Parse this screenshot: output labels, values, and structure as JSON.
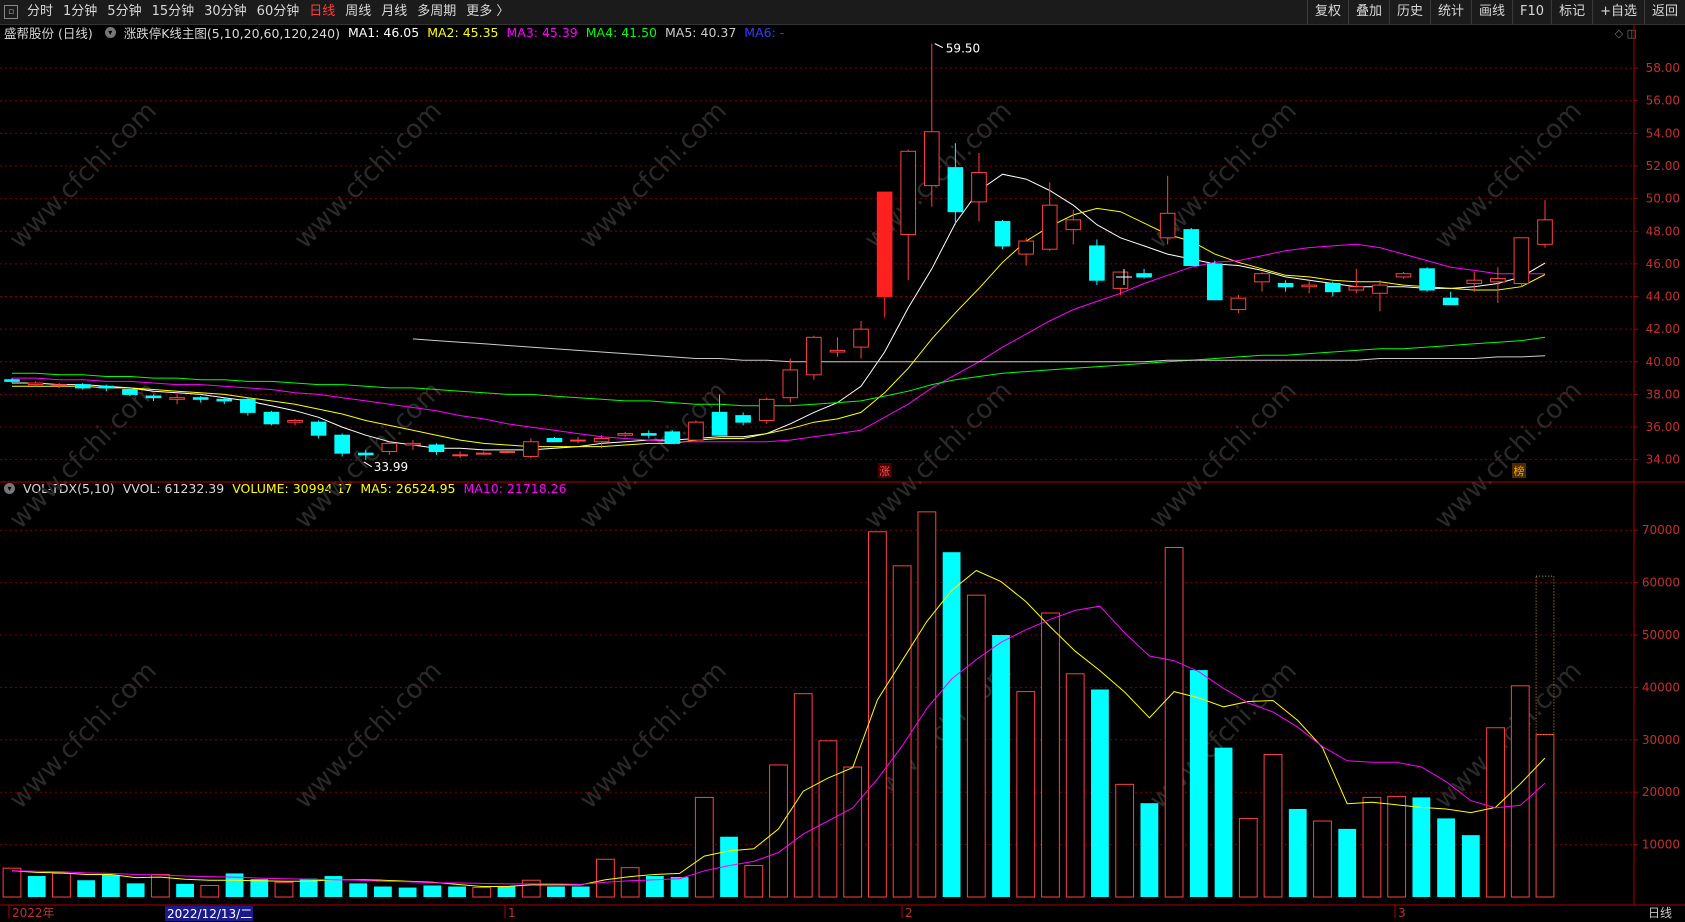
{
  "toolbar": {
    "icon": "window-menu-icon",
    "periods": [
      "分时",
      "1分钟",
      "5分钟",
      "15分钟",
      "30分钟",
      "60分钟",
      "日线",
      "周线",
      "月线",
      "多周期",
      "更多 〉"
    ],
    "active_period": "日线",
    "right_buttons": [
      "复权",
      "叠加",
      "历史",
      "统计",
      "画线",
      "F10",
      "标记",
      "+自选",
      "返回"
    ]
  },
  "price_panel": {
    "stock": "盛帮股份 (日线)",
    "indicator": "涨跌停K线主图(5,10,20,60,120,240)",
    "ma1": "MA1: 46.05",
    "ma2": "MA2: 45.35",
    "ma3": "MA3: 45.39",
    "ma4": "MA4: 41.50",
    "ma5": "MA5: 40.37",
    "ma6": "MA6: -",
    "high_label": "59.50",
    "low_label": "33.99",
    "limit_up_mark": "涨",
    "rank_mark": "榜",
    "corner_icons": "◇ ◫"
  },
  "volume_panel": {
    "indicator": "VOL-TDX(5,10)",
    "vvol": "VVOL: 61232.39",
    "volume": "VOLUME: 30994.17",
    "ma5": "MA5: 26524.95",
    "ma10": "MA10: 21718.26"
  },
  "time_axis": {
    "labels": [
      "2022年",
      "1",
      "2",
      "3"
    ],
    "cursor_date": "2022/12/13/二",
    "period_label": "日线"
  },
  "watermark": "www.cfchi.com",
  "colors": {
    "up": "#ff4040",
    "down": "#00ffff",
    "ma1": "#ffffff",
    "ma2": "#ffff00",
    "ma3": "#ff00ff",
    "ma4": "#00ff00",
    "ma5": "#cccccc",
    "ma6": "#0000ff",
    "grid": "#7a0000"
  },
  "chart_data": [
    {
      "type": "candlestick",
      "title": "盛帮股份 (日线)",
      "y_ticks": [
        34.0,
        36.0,
        38.0,
        40.0,
        42.0,
        44.0,
        46.0,
        48.0,
        50.0,
        52.0,
        54.0,
        56.0,
        58.0
      ],
      "ylim": [
        33.0,
        59.6
      ],
      "ohlc": [
        [
          38.9,
          39.0,
          38.7,
          38.8
        ],
        [
          38.6,
          38.8,
          38.5,
          38.7
        ],
        [
          38.6,
          38.7,
          38.4,
          38.6
        ],
        [
          38.6,
          38.7,
          38.3,
          38.4
        ],
        [
          38.5,
          38.6,
          38.2,
          38.4
        ],
        [
          38.3,
          38.4,
          37.9,
          38.0
        ],
        [
          37.9,
          38.0,
          37.6,
          37.8
        ],
        [
          37.7,
          38.0,
          37.4,
          37.8
        ],
        [
          37.8,
          37.9,
          37.5,
          37.7
        ],
        [
          37.7,
          37.8,
          37.4,
          37.6
        ],
        [
          37.7,
          37.8,
          36.7,
          36.9
        ],
        [
          36.9,
          37.0,
          36.1,
          36.2
        ],
        [
          36.3,
          36.5,
          36.1,
          36.4
        ],
        [
          36.3,
          36.4,
          35.3,
          35.5
        ],
        [
          35.5,
          35.6,
          34.2,
          34.4
        ],
        [
          34.4,
          34.6,
          33.99,
          34.3
        ],
        [
          34.5,
          35.1,
          34.3,
          35.0
        ],
        [
          34.9,
          35.2,
          34.6,
          35.0
        ],
        [
          34.9,
          35.0,
          34.3,
          34.5
        ],
        [
          34.3,
          34.5,
          34.1,
          34.3
        ],
        [
          34.4,
          34.5,
          34.3,
          34.4
        ],
        [
          34.5,
          34.6,
          34.4,
          34.5
        ],
        [
          34.2,
          35.3,
          34.1,
          35.1
        ],
        [
          35.3,
          35.4,
          35.1,
          35.1
        ],
        [
          35.2,
          35.4,
          35.0,
          35.2
        ],
        [
          35.1,
          35.5,
          34.7,
          35.3
        ],
        [
          35.5,
          35.7,
          35.4,
          35.6
        ],
        [
          35.6,
          35.8,
          35.3,
          35.5
        ],
        [
          35.7,
          35.8,
          35.0,
          35.0
        ],
        [
          35.2,
          36.4,
          35.1,
          36.3
        ],
        [
          36.9,
          38.0,
          35.8,
          35.5
        ],
        [
          36.7,
          36.9,
          36.1,
          36.3
        ],
        [
          36.4,
          37.8,
          36.2,
          37.7
        ],
        [
          37.8,
          40.2,
          37.5,
          39.5
        ],
        [
          39.2,
          41.6,
          38.9,
          41.5
        ],
        [
          40.6,
          41.5,
          40.3,
          40.7
        ],
        [
          40.9,
          42.5,
          40.2,
          42.0
        ],
        [
          44.0,
          50.4,
          42.7,
          50.4
        ],
        [
          47.8,
          53.0,
          45.0,
          52.9
        ],
        [
          50.8,
          59.5,
          49.5,
          54.1
        ],
        [
          51.9,
          53.4,
          48.4,
          49.2
        ],
        [
          49.8,
          52.8,
          48.6,
          51.6
        ],
        [
          48.6,
          48.7,
          46.9,
          47.1
        ],
        [
          46.6,
          47.6,
          45.9,
          47.4
        ],
        [
          46.9,
          51.0,
          46.8,
          49.6
        ],
        [
          48.1,
          49.3,
          47.2,
          48.7
        ],
        [
          47.1,
          47.5,
          44.7,
          45.0
        ],
        [
          44.5,
          45.5,
          44.1,
          45.5
        ],
        [
          45.4,
          45.7,
          45.1,
          45.2
        ],
        [
          47.6,
          51.4,
          47.2,
          49.1
        ],
        [
          48.1,
          48.2,
          45.9,
          45.9
        ],
        [
          46.0,
          46.2,
          43.8,
          43.8
        ],
        [
          43.2,
          44.1,
          43.0,
          43.9
        ],
        [
          44.9,
          45.5,
          44.3,
          45.4
        ],
        [
          44.8,
          45.0,
          44.3,
          44.6
        ],
        [
          44.6,
          45.0,
          44.2,
          44.7
        ],
        [
          44.8,
          44.9,
          44.0,
          44.3
        ],
        [
          44.4,
          45.7,
          44.2,
          44.6
        ],
        [
          44.2,
          45.0,
          43.1,
          44.7
        ],
        [
          45.2,
          45.5,
          45.1,
          45.4
        ],
        [
          45.7,
          45.8,
          44.3,
          44.4
        ],
        [
          43.9,
          44.3,
          43.5,
          43.5
        ],
        [
          44.8,
          45.5,
          44.3,
          45.0
        ],
        [
          44.9,
          45.8,
          43.6,
          45.1
        ],
        [
          44.8,
          47.2,
          44.6,
          47.6
        ],
        [
          47.2,
          49.9,
          47.0,
          48.7
        ]
      ],
      "series": [
        {
          "name": "MA1",
          "values": [
            38.7,
            38.7,
            38.6,
            38.6,
            38.5,
            38.4,
            38.2,
            38.1,
            38.0,
            37.8,
            37.6,
            37.3,
            37.0,
            36.6,
            36.0,
            35.5,
            35.1,
            34.9,
            34.7,
            34.7,
            34.6,
            34.6,
            34.6,
            34.7,
            34.8,
            35.0,
            35.1,
            35.2,
            35.2,
            35.3,
            35.4,
            35.4,
            35.6,
            36.2,
            36.9,
            37.5,
            38.5,
            40.6,
            43.3,
            45.7,
            48.5,
            50.5,
            51.5,
            51.2,
            50.5,
            49.6,
            48.4,
            47.6,
            47.1,
            46.6,
            46.3,
            46.0,
            45.9,
            45.6,
            45.2,
            45.0,
            44.8,
            44.6,
            44.6,
            44.6,
            44.5,
            44.5,
            44.6,
            44.8,
            45.2,
            46.05
          ]
        },
        {
          "name": "MA2",
          "values": [
            38.5,
            38.5,
            38.5,
            38.5,
            38.4,
            38.4,
            38.3,
            38.2,
            38.1,
            38.0,
            37.8,
            37.6,
            37.4,
            37.1,
            36.8,
            36.4,
            36.1,
            35.8,
            35.5,
            35.2,
            35.0,
            34.9,
            34.8,
            34.8,
            34.8,
            34.8,
            34.9,
            35.0,
            35.0,
            35.2,
            35.3,
            35.3,
            35.6,
            35.9,
            36.3,
            36.5,
            36.9,
            38.1,
            39.6,
            41.4,
            43.0,
            44.5,
            46.1,
            47.4,
            48.3,
            49.0,
            49.4,
            49.2,
            48.5,
            47.8,
            47.4,
            46.6,
            46.1,
            45.7,
            45.3,
            45.2,
            45.0,
            44.9,
            44.9,
            44.7,
            44.6,
            44.5,
            44.4,
            44.4,
            44.6,
            45.35
          ]
        },
        {
          "name": "MA3",
          "values": [
            39.0,
            39.0,
            38.9,
            38.9,
            38.8,
            38.8,
            38.7,
            38.6,
            38.6,
            38.5,
            38.4,
            38.3,
            38.1,
            38.0,
            37.8,
            37.6,
            37.4,
            37.2,
            37.0,
            36.7,
            36.5,
            36.2,
            36.0,
            35.8,
            35.6,
            35.4,
            35.3,
            35.2,
            35.1,
            35.1,
            35.1,
            35.1,
            35.1,
            35.2,
            35.4,
            35.6,
            35.8,
            36.6,
            37.4,
            38.4,
            39.2,
            40.0,
            40.9,
            41.7,
            42.5,
            43.2,
            43.7,
            44.2,
            44.8,
            45.3,
            45.8,
            46.1,
            46.2,
            46.5,
            46.8,
            47.0,
            47.1,
            47.2,
            47.0,
            46.6,
            46.2,
            45.8,
            45.6,
            45.4,
            45.4,
            45.39
          ]
        },
        {
          "name": "MA4",
          "values": [
            39.3,
            39.3,
            39.2,
            39.2,
            39.1,
            39.1,
            39.0,
            39.0,
            38.9,
            38.9,
            38.8,
            38.8,
            38.7,
            38.6,
            38.6,
            38.5,
            38.4,
            38.4,
            38.3,
            38.2,
            38.1,
            38.0,
            38.0,
            37.9,
            37.8,
            37.7,
            37.6,
            37.6,
            37.5,
            37.4,
            37.4,
            37.3,
            37.3,
            37.3,
            37.4,
            37.5,
            37.6,
            37.9,
            38.2,
            38.6,
            38.9,
            39.1,
            39.3,
            39.4,
            39.5,
            39.6,
            39.7,
            39.8,
            39.9,
            40.0,
            40.1,
            40.2,
            40.3,
            40.4,
            40.4,
            40.5,
            40.6,
            40.7,
            40.8,
            40.8,
            40.9,
            41.0,
            41.1,
            41.2,
            41.3,
            41.5
          ]
        },
        {
          "name": "MA5",
          "values": [
            null,
            null,
            null,
            null,
            null,
            null,
            null,
            null,
            null,
            null,
            null,
            null,
            null,
            null,
            null,
            null,
            null,
            41.4,
            41.3,
            41.2,
            41.1,
            41.0,
            40.9,
            40.8,
            40.7,
            40.6,
            40.5,
            40.4,
            40.3,
            40.2,
            40.2,
            40.1,
            40.1,
            40.0,
            40.0,
            40.0,
            40.0,
            40.0,
            40.0,
            40.0,
            40.0,
            40.0,
            40.0,
            40.0,
            40.0,
            40.0,
            40.0,
            40.0,
            40.0,
            40.1,
            40.1,
            40.1,
            40.1,
            40.1,
            40.1,
            40.1,
            40.1,
            40.1,
            40.2,
            40.2,
            40.2,
            40.2,
            40.2,
            40.3,
            40.3,
            40.37
          ]
        }
      ]
    },
    {
      "type": "bar",
      "title": "VOL-TDX(5,10)",
      "y_ticks": [
        10000,
        20000,
        30000,
        40000,
        50000,
        60000,
        70000
      ],
      "ylim": [
        0,
        75000
      ],
      "values": [
        5500,
        4000,
        4500,
        3200,
        4200,
        2600,
        4300,
        2500,
        2200,
        4500,
        3400,
        2800,
        3500,
        4000,
        2600,
        2000,
        1800,
        2200,
        2000,
        1800,
        2100,
        3200,
        2000,
        2000,
        7200,
        5600,
        4000,
        3800,
        19000,
        11500,
        6000,
        25200,
        38800,
        29800,
        24800,
        69700,
        63200,
        73500,
        65800,
        57600,
        50000,
        39200,
        54200,
        42600,
        39600,
        21500,
        17900,
        66700,
        43300,
        28500,
        15000,
        27200,
        16800,
        14500,
        13000,
        19000,
        19200,
        19000,
        15000,
        11800,
        32300,
        40300,
        30994
      ],
      "down": [
        false,
        true,
        false,
        true,
        true,
        true,
        false,
        true,
        false,
        true,
        true,
        false,
        true,
        true,
        true,
        true,
        true,
        true,
        true,
        false,
        true,
        false,
        true,
        true,
        false,
        false,
        true,
        true,
        false,
        true,
        false,
        false,
        false,
        false,
        false,
        false,
        false,
        false,
        true,
        false,
        true,
        false,
        false,
        false,
        true,
        false,
        true,
        false,
        true,
        true,
        false,
        false,
        true,
        false,
        true,
        false,
        false,
        true,
        true,
        true,
        false,
        false,
        false
      ],
      "vvol": 61232.39,
      "series": [
        {
          "name": "MA5",
          "values": [
            5000,
            4700,
            4600,
            4300,
            4300,
            3700,
            3800,
            3400,
            3200,
            3200,
            3100,
            3000,
            3000,
            3300,
            3300,
            3200,
            3000,
            2800,
            2400,
            2000,
            2000,
            2300,
            2300,
            2300,
            3300,
            3900,
            4300,
            4500,
            7800,
            8800,
            9200,
            13000,
            20200,
            22700,
            24700,
            37600,
            45100,
            52600,
            58500,
            62300,
            60200,
            56400,
            51500,
            46900,
            43200,
            39100,
            34200,
            39200,
            38000,
            36300,
            37300,
            37500,
            33700,
            28500,
            17800,
            18100,
            17600,
            17100,
            16800,
            16100,
            17100,
            21600,
            26524.95
          ]
        },
        {
          "name": "MA10",
          "values": [
            5000,
            4900,
            4800,
            4600,
            4500,
            4300,
            4200,
            4000,
            3900,
            3800,
            3600,
            3500,
            3400,
            3300,
            3200,
            3000,
            2900,
            2700,
            2700,
            2600,
            2500,
            2500,
            2500,
            2400,
            2800,
            3100,
            3300,
            3500,
            5000,
            6000,
            6800,
            8500,
            12000,
            14500,
            17000,
            22500,
            28800,
            36000,
            41600,
            45300,
            48600,
            51000,
            53000,
            54700,
            55500,
            50400,
            46000,
            45100,
            43000,
            39800,
            37000,
            35300,
            32400,
            28700,
            26000,
            25700,
            25700,
            24800,
            22000,
            18400,
            17000,
            17500,
            21718.26
          ]
        }
      ]
    }
  ]
}
